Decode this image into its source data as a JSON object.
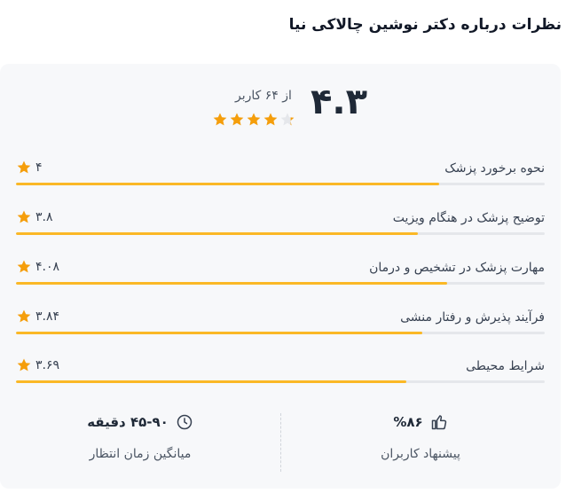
{
  "page_title": "نظرات درباره دکتر نوشین چالاکی نیا",
  "summary": {
    "score": "۴.۳",
    "count_text": "از ۶۴ کاربر",
    "rating_fraction": 0.86
  },
  "criteria": [
    {
      "label": "نحوه برخورد پزشک",
      "value": "۴",
      "fraction": 0.8
    },
    {
      "label": "توضیح پزشک در هنگام ویزیت",
      "value": "۳.۸",
      "fraction": 0.76
    },
    {
      "label": "مهارت پزشک در تشخیص و درمان",
      "value": "۴.۰۸",
      "fraction": 0.816
    },
    {
      "label": "فرآیند پذیرش و رفتار منشی",
      "value": "۳.۸۴",
      "fraction": 0.768
    },
    {
      "label": "شرایط محیطی",
      "value": "۳.۶۹",
      "fraction": 0.738
    }
  ],
  "stats": {
    "recommend_value": "%۸۶",
    "recommend_label": "پیشنهاد کاربران",
    "wait_value": "۴۵-۹۰ دقیقه",
    "wait_label": "میانگین زمان انتظار"
  },
  "colors": {
    "star": "#f59e0b",
    "bar_fill": "#fbb826",
    "bar_track": "#e5e7eb",
    "card_bg": "#f7f8fa"
  },
  "icons": {
    "recommend": "thumbs-up-icon",
    "wait": "clock-icon",
    "rating": "star-icon"
  }
}
